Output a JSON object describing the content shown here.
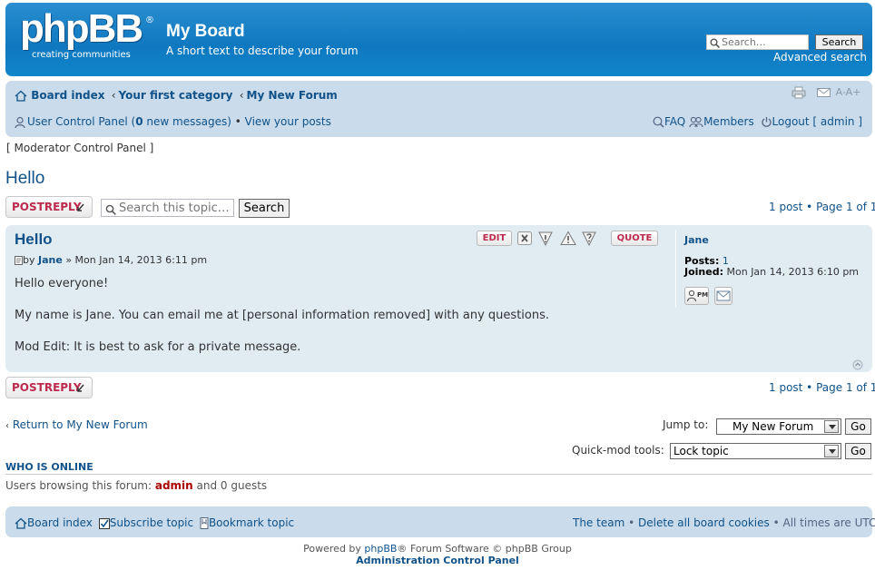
{
  "header": {
    "logo_text": "phpBB",
    "logo_reg": "®",
    "logo_tagline": "creating communities",
    "site_title": "My Board",
    "site_description": "A short text to describe your forum",
    "search_placeholder": "Search…",
    "search_button": "Search",
    "advanced_search": "Advanced search"
  },
  "nav": {
    "breadcrumbs": [
      "Board index",
      "Your first category",
      "My New Forum"
    ],
    "breadcrumb_sep": "‹",
    "font_size_label": "A-A+",
    "ucp_prefix": "User Control Panel (",
    "new_count": "0",
    "ucp_suffix": " new messages)",
    "bullet": "•",
    "view_posts": "View your posts",
    "faq": "FAQ",
    "members": "Members",
    "logout": "Logout [ admin ]"
  },
  "mcp_link": "[ Moderator Control Panel ]",
  "topic": {
    "title": "Hello",
    "reply_button": "POSTREPLY",
    "topic_search_placeholder": "Search this topic…",
    "topic_search_button": "Search",
    "pagination": "1 post • Page 1 of 1"
  },
  "post": {
    "title": "Hello",
    "by": "by",
    "author": "Jane",
    "date": "» Mon Jan 14, 2013 6:11 pm",
    "edit": "EDIT",
    "quote": "QUOTE",
    "content": [
      "Hello everyone!",
      "My name is Jane. You can email me at [personal information removed] with any questions.",
      "Mod Edit: It is best to ask for a private message."
    ],
    "profile": {
      "name": "Jane",
      "posts_label": "Posts:",
      "posts_value": "1",
      "joined_label": "Joined:",
      "joined_value": "Mon Jan 14, 2013 6:10 pm",
      "pm_label": "PM"
    }
  },
  "bottom": {
    "return_link": "Return to My New Forum",
    "jump_label": "Jump to:",
    "jump_value": "My New Forum",
    "go": "Go",
    "quickmod_label": "Quick-mod tools:",
    "quickmod_value": "Lock topic"
  },
  "online": {
    "heading": "WHO IS ONLINE",
    "prefix": "Users browsing this forum: ",
    "user": "admin",
    "suffix": " and 0 guests"
  },
  "footer_nav": {
    "board_index": "Board index",
    "subscribe": "Subscribe topic",
    "bookmark": "Bookmark topic",
    "team": "The team",
    "delete_cookies": "Delete all board cookies",
    "times": "All times are UTC"
  },
  "copyright": {
    "prefix": "Powered by ",
    "brand": "phpBB",
    "suffix": "® Forum Software © phpBB Group",
    "acp": "Administration Control Panel"
  },
  "colors": {
    "header_blue": "#0e78c0",
    "navbar_bg": "#cadceb",
    "post_bg": "#e1ebf2",
    "link": "#105289",
    "reply_red": "#bc2a4d"
  }
}
